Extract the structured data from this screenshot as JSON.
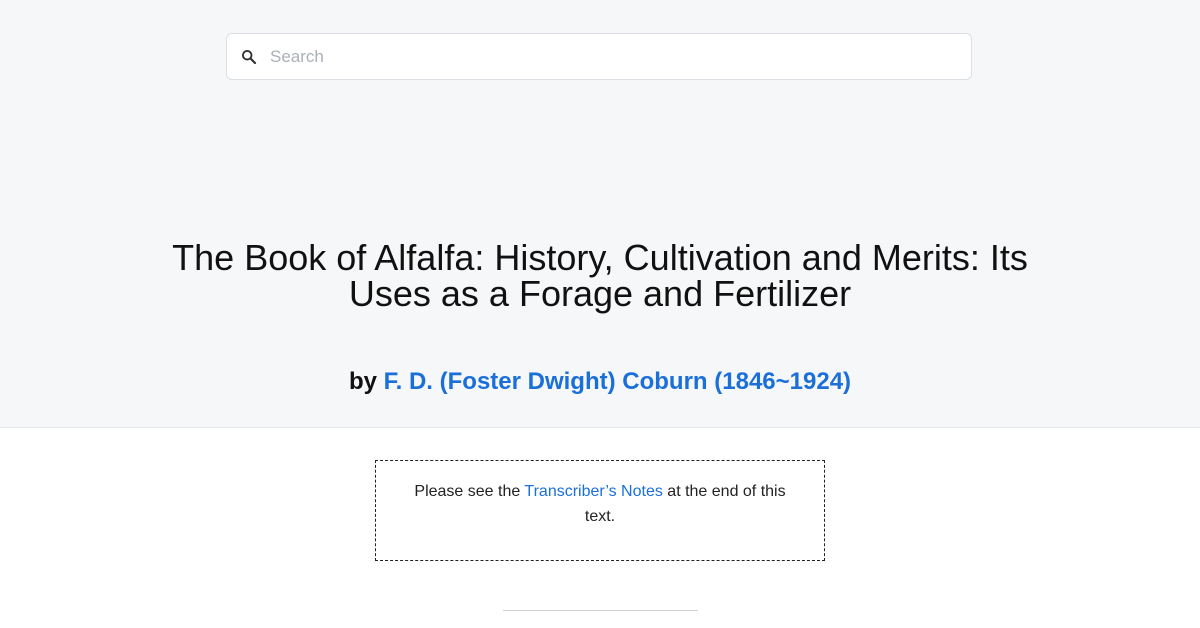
{
  "search": {
    "placeholder": "Search"
  },
  "book": {
    "title": "The Book of Alfalfa: History, Cultivation and Merits: Its Uses as a Forage and Fertilizer",
    "by_prefix": "by ",
    "author": "F. D. (Foster Dwight) Coburn (1846~1924)"
  },
  "note": {
    "before": "Please see the ",
    "link": "Transcriber’s Notes",
    "after": " at the end of this text."
  },
  "colors": {
    "link": "#1a6fd8",
    "header_bg": "#f6f7f9"
  },
  "icons": {
    "search": "search-icon"
  }
}
